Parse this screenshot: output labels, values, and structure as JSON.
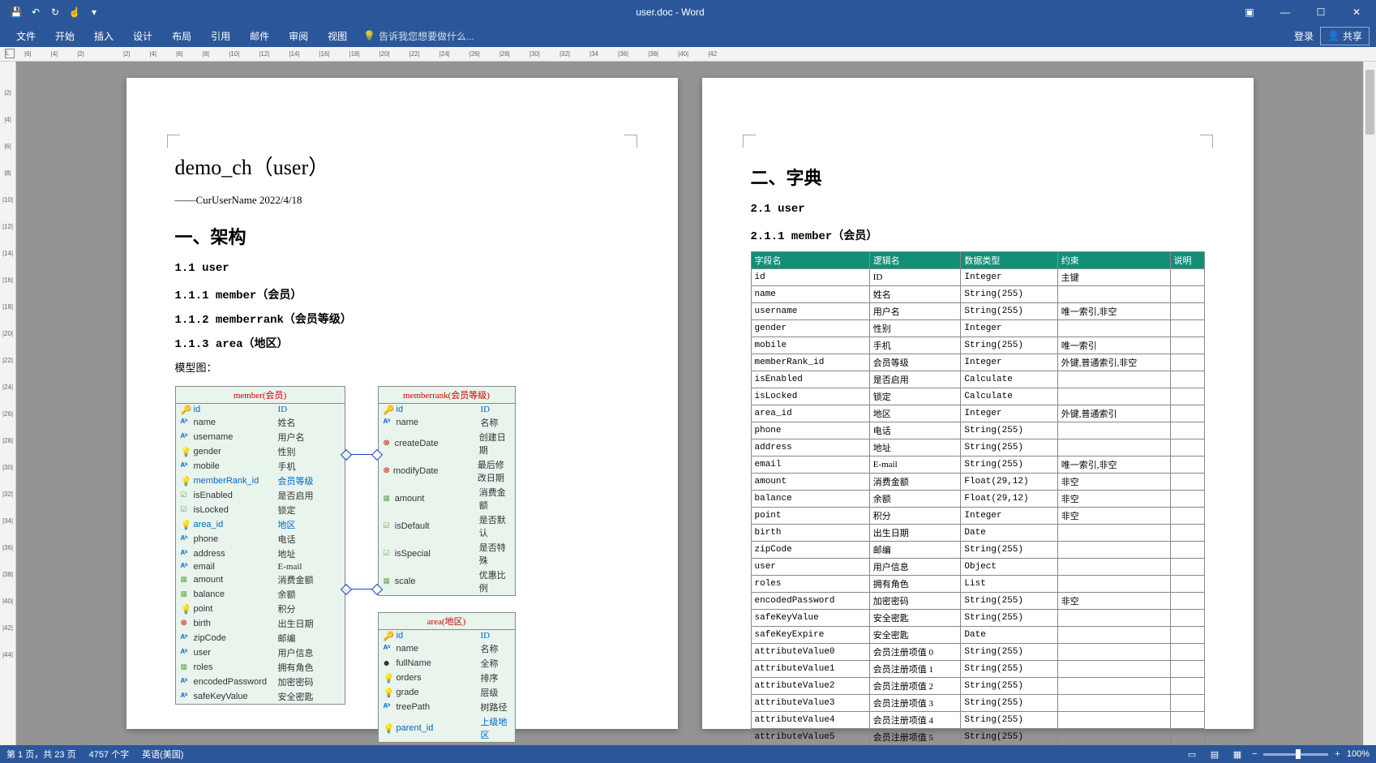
{
  "window": {
    "title": "user.doc - Word",
    "login": "登录",
    "share": "共享"
  },
  "ribbon": {
    "tabs": [
      "文件",
      "开始",
      "插入",
      "设计",
      "布局",
      "引用",
      "邮件",
      "审阅",
      "视图"
    ],
    "tellme_placeholder": "告诉我您想要做什么..."
  },
  "ruler_h": [
    "|6|",
    "|4|",
    "|2|",
    "",
    "|2|",
    "|4|",
    "|6|",
    "|8|",
    "|10|",
    "|12|",
    "|14|",
    "|16|",
    "|18|",
    "|20|",
    "|22|",
    "|24|",
    "|26|",
    "|28|",
    "|30|",
    "|32|",
    "|34",
    "|36|",
    "|38|",
    "|40|",
    "|42"
  ],
  "ruler_v": [
    "",
    "|2|",
    "|4|",
    "|6|",
    "|8|",
    "|10|",
    "|12|",
    "|14|",
    "|16|",
    "|18|",
    "|20|",
    "|22|",
    "|24|",
    "|26|",
    "|28|",
    "|30|",
    "|32|",
    "|34|",
    "|36|",
    "|38|",
    "|40|",
    "|42|",
    "|44|"
  ],
  "page1": {
    "title": "demo_ch（user）",
    "meta": "——CurUserName 2022/4/18",
    "h1_1": "一、架构",
    "h2_1": "1.1 user",
    "h3_1": "1.1.1 member（会员）",
    "h3_2": "1.1.2 memberrank（会员等级）",
    "h3_3": "1.1.3 area（地区）",
    "body_model": "模型图：",
    "entities": {
      "member": {
        "title": "member(会员)",
        "rows": [
          {
            "ic": "key",
            "field": "id",
            "cn": "ID",
            "pk": true
          },
          {
            "ic": "abc",
            "field": "name",
            "cn": "姓名"
          },
          {
            "ic": "abc",
            "field": "username",
            "cn": "用户名"
          },
          {
            "ic": "lamp",
            "field": "gender",
            "cn": "性别"
          },
          {
            "ic": "abc",
            "field": "mobile",
            "cn": "手机"
          },
          {
            "ic": "lamp",
            "field": "memberRank_id",
            "cn": "会员等级",
            "fk": true
          },
          {
            "ic": "chk",
            "field": "isEnabled",
            "cn": "是否启用"
          },
          {
            "ic": "chk",
            "field": "isLocked",
            "cn": "锁定"
          },
          {
            "ic": "lamp",
            "field": "area_id",
            "cn": "地区",
            "fk": true
          },
          {
            "ic": "abc",
            "field": "phone",
            "cn": "电话"
          },
          {
            "ic": "abc",
            "field": "address",
            "cn": "地址"
          },
          {
            "ic": "abc",
            "field": "email",
            "cn": "E-mail"
          },
          {
            "ic": "grid",
            "field": "amount",
            "cn": "消费金额"
          },
          {
            "ic": "grid",
            "field": "balance",
            "cn": "余额"
          },
          {
            "ic": "lamp",
            "field": "point",
            "cn": "积分"
          },
          {
            "ic": "x",
            "field": "birth",
            "cn": "出生日期"
          },
          {
            "ic": "abc",
            "field": "zipCode",
            "cn": "邮编"
          },
          {
            "ic": "abc",
            "field": "user",
            "cn": "用户信息"
          },
          {
            "ic": "grid",
            "field": "roles",
            "cn": "拥有角色"
          },
          {
            "ic": "abc",
            "field": "encodedPassword",
            "cn": "加密密码"
          },
          {
            "ic": "abc",
            "field": "safeKeyValue",
            "cn": "安全密匙"
          }
        ]
      },
      "memberrank": {
        "title": "memberrank(会员等级)",
        "rows": [
          {
            "ic": "key",
            "field": "id",
            "cn": "ID",
            "pk": true
          },
          {
            "ic": "abc",
            "field": "name",
            "cn": "名称"
          },
          {
            "ic": "x",
            "field": "createDate",
            "cn": "创建日期"
          },
          {
            "ic": "x",
            "field": "modifyDate",
            "cn": "最后修改日期"
          },
          {
            "ic": "grid",
            "field": "amount",
            "cn": "消费金额"
          },
          {
            "ic": "chk",
            "field": "isDefault",
            "cn": "是否默认"
          },
          {
            "ic": "chk",
            "field": "isSpecial",
            "cn": "是否特殊"
          },
          {
            "ic": "grid",
            "field": "scale",
            "cn": "优惠比例"
          }
        ]
      },
      "area": {
        "title": "area(地区)",
        "rows": [
          {
            "ic": "key",
            "field": "id",
            "cn": "ID",
            "pk": true
          },
          {
            "ic": "abc",
            "field": "name",
            "cn": "名称"
          },
          {
            "ic": "dot",
            "field": "fullName",
            "cn": "全称"
          },
          {
            "ic": "lamp",
            "field": "orders",
            "cn": "排序"
          },
          {
            "ic": "lamp",
            "field": "grade",
            "cn": "层级"
          },
          {
            "ic": "abc",
            "field": "treePath",
            "cn": "树路径"
          },
          {
            "ic": "lamp",
            "field": "parent_id",
            "cn": "上级地区",
            "fk": true
          }
        ]
      }
    }
  },
  "page2": {
    "h1_1": "二、字典",
    "h2_1": "2.1 user",
    "h3_1": "2.1.1 member（会员）",
    "table_headers": [
      "字段名",
      "逻辑名",
      "数据类型",
      "约束",
      "说明"
    ],
    "table_rows": [
      [
        "id",
        "ID",
        "Integer",
        "主键",
        ""
      ],
      [
        "name",
        "姓名",
        "String(255)",
        "",
        ""
      ],
      [
        "username",
        "用户名",
        "String(255)",
        "唯一索引,非空",
        ""
      ],
      [
        "gender",
        "性别",
        "Integer",
        "",
        ""
      ],
      [
        "mobile",
        "手机",
        "String(255)",
        "唯一索引",
        ""
      ],
      [
        "memberRank_id",
        "会员等级",
        "Integer",
        "外键,普通索引,非空",
        ""
      ],
      [
        "isEnabled",
        "是否启用",
        "Calculate",
        "",
        ""
      ],
      [
        "isLocked",
        "锁定",
        "Calculate",
        "",
        ""
      ],
      [
        "area_id",
        "地区",
        "Integer",
        "外键,普通索引",
        ""
      ],
      [
        "phone",
        "电话",
        "String(255)",
        "",
        ""
      ],
      [
        "address",
        "地址",
        "String(255)",
        "",
        ""
      ],
      [
        "email",
        "E-mail",
        "String(255)",
        "唯一索引,非空",
        ""
      ],
      [
        "amount",
        "消费金额",
        "Float(29,12)",
        "非空",
        ""
      ],
      [
        "balance",
        "余额",
        "Float(29,12)",
        "非空",
        ""
      ],
      [
        "point",
        "积分",
        "Integer",
        "非空",
        ""
      ],
      [
        "birth",
        "出生日期",
        "Date",
        "",
        ""
      ],
      [
        "zipCode",
        "邮编",
        "String(255)",
        "",
        ""
      ],
      [
        "user",
        "用户信息",
        "Object",
        "",
        ""
      ],
      [
        "roles",
        "拥有角色",
        "List",
        "",
        ""
      ],
      [
        "encodedPassword",
        "加密密码",
        "String(255)",
        "非空",
        ""
      ],
      [
        "safeKeyValue",
        "安全密匙",
        "String(255)",
        "",
        ""
      ],
      [
        "safeKeyExpire",
        "安全密匙",
        "Date",
        "",
        ""
      ],
      [
        "attributeValue0",
        "会员注册项值 0",
        "String(255)",
        "",
        ""
      ],
      [
        "attributeValue1",
        "会员注册项值 1",
        "String(255)",
        "",
        ""
      ],
      [
        "attributeValue2",
        "会员注册项值 2",
        "String(255)",
        "",
        ""
      ],
      [
        "attributeValue3",
        "会员注册项值 3",
        "String(255)",
        "",
        ""
      ],
      [
        "attributeValue4",
        "会员注册项值 4",
        "String(255)",
        "",
        ""
      ],
      [
        "attributeValue5",
        "会员注册项值 5",
        "String(255)",
        "",
        ""
      ]
    ]
  },
  "status": {
    "page": "第 1 页，共 23 页",
    "words": "4757 个字",
    "lang": "英语(美国)",
    "zoom": "100%"
  }
}
